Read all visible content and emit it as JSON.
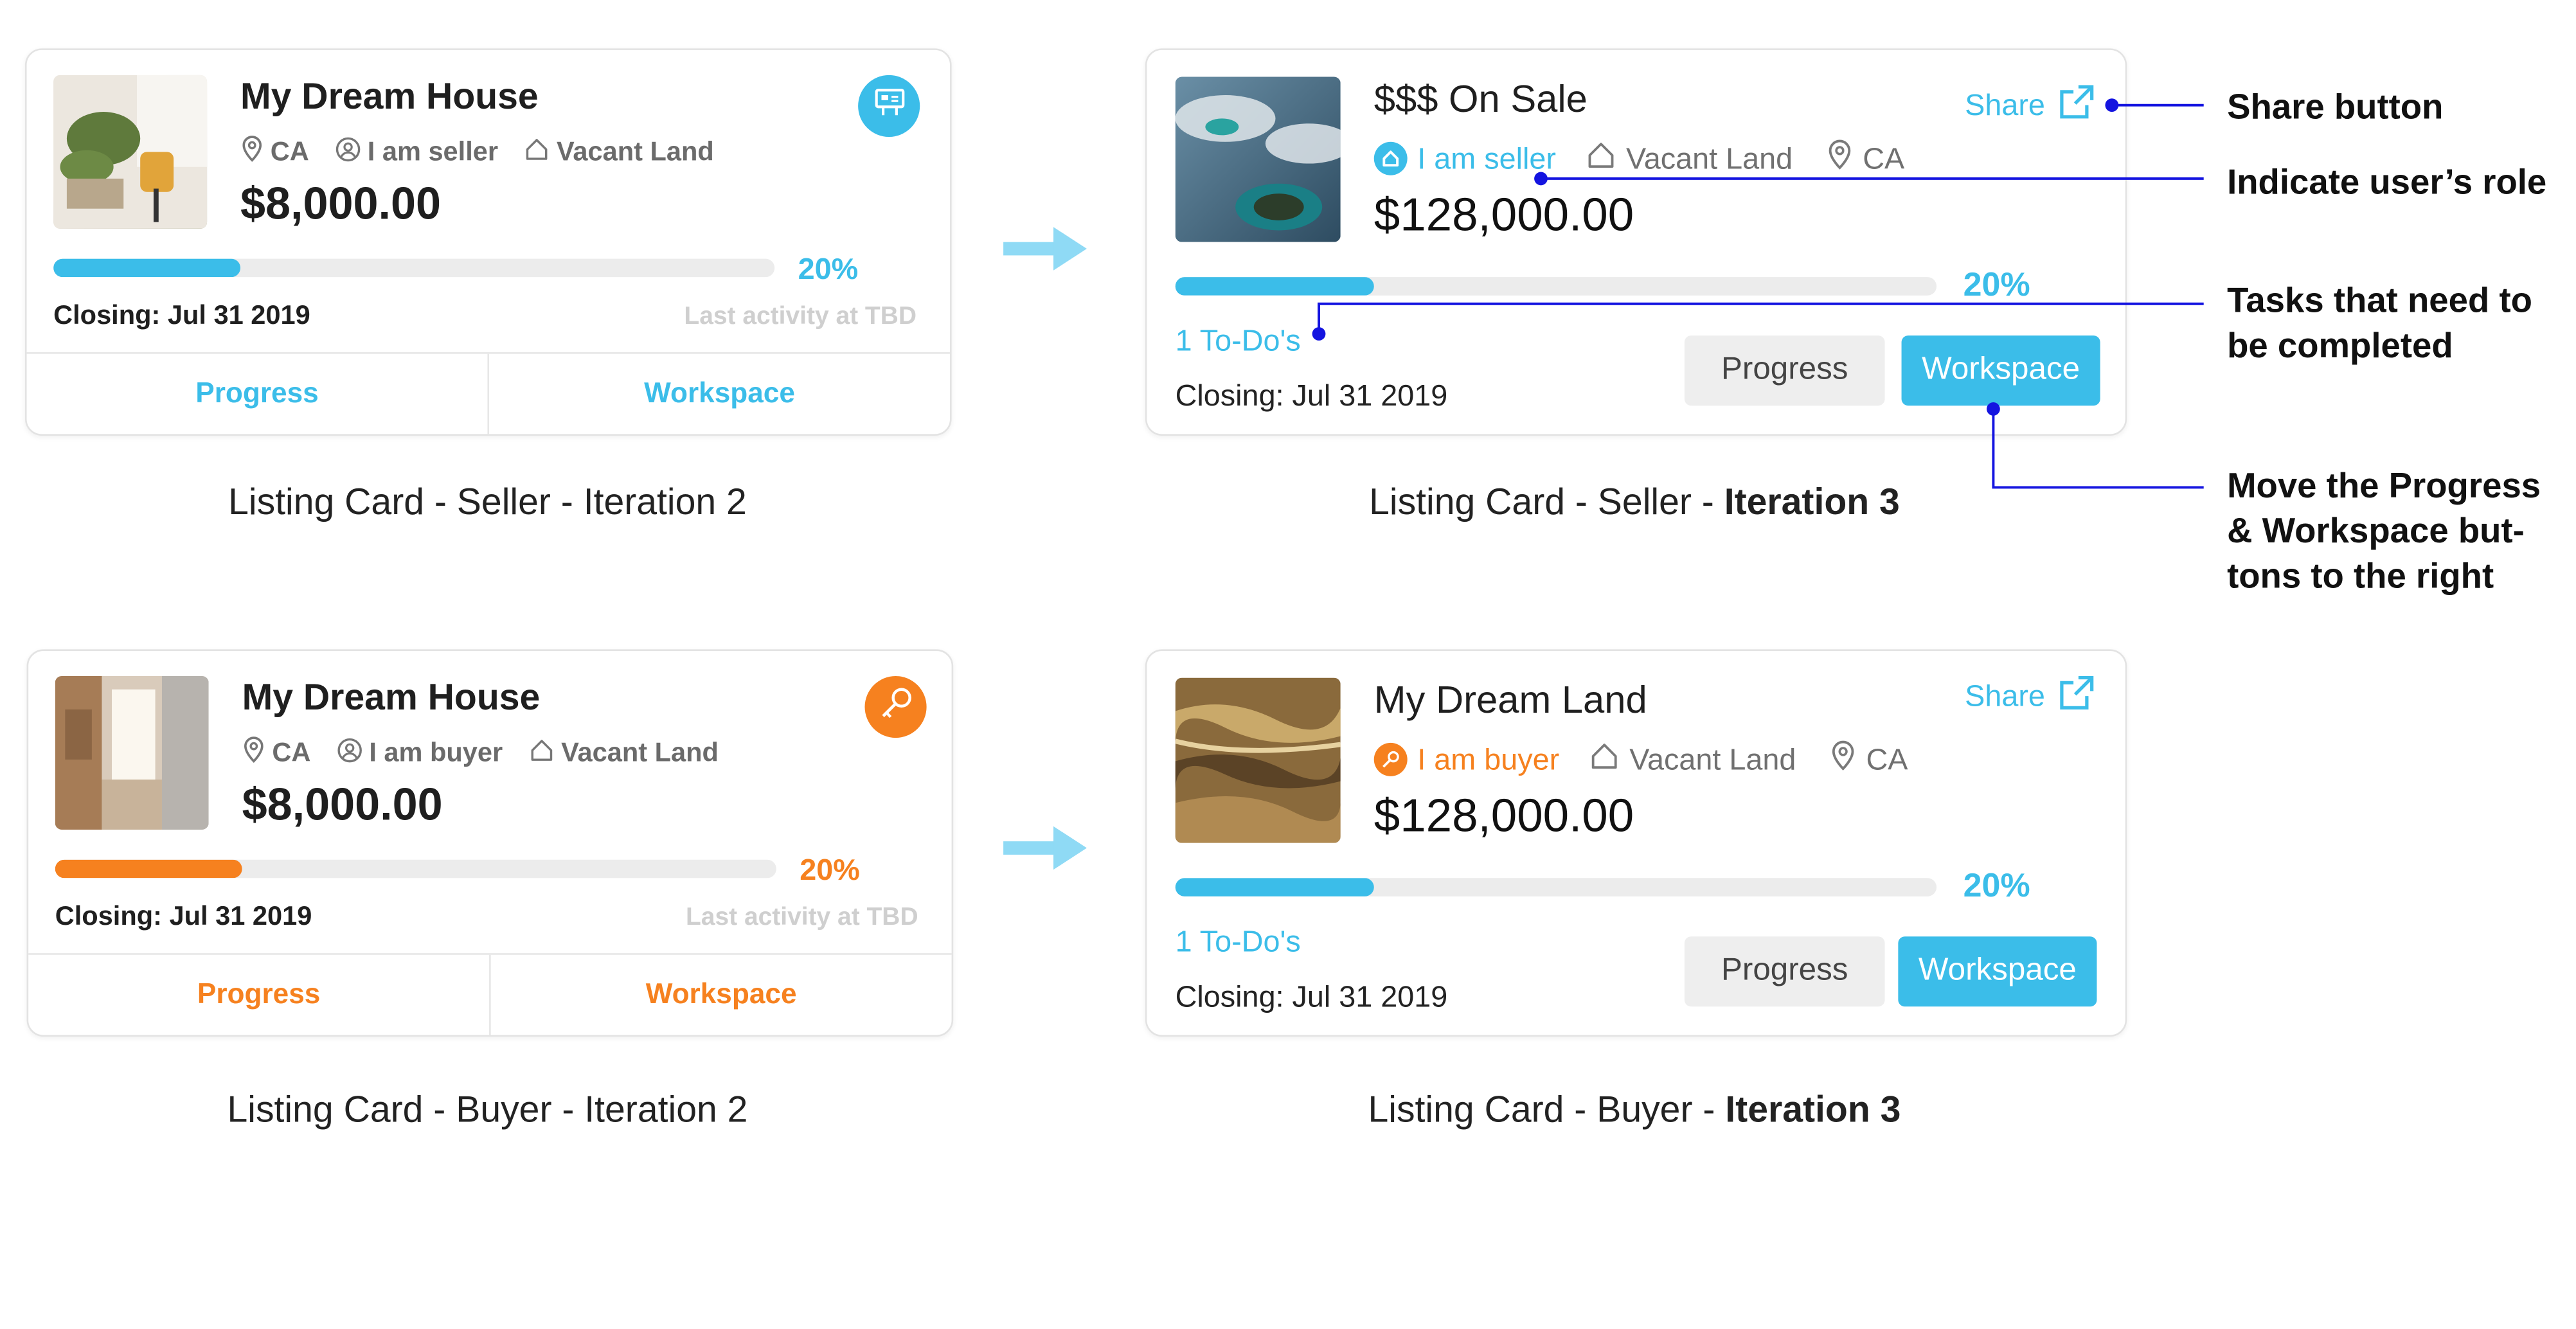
{
  "colors": {
    "seller_accent": "#3bbde9",
    "buyer_accent": "#f6811f",
    "annotation_line": "#1414e0",
    "arrow": "#8fdaf5",
    "gray_button": "#eeeeee"
  },
  "cards": {
    "seller_v2": {
      "title": "My Dream House",
      "location": "CA",
      "role": "I am seller",
      "property_type": "Vacant Land",
      "price": "$8,000.00",
      "progress_value": 0.2,
      "progress_label": "20%",
      "closing": "Closing: Jul 31 2019",
      "last_activity": "Last activity at TBD",
      "progress_button": "Progress",
      "workspace_button": "Workspace",
      "badge_icon": "sale-sign-icon",
      "thumbnail": "living-room-plants-photo"
    },
    "seller_v3": {
      "title": "$$$ On Sale",
      "role": "I am seller",
      "property_type": "Vacant Land",
      "location": "CA",
      "price": "$128,000.00",
      "progress_value": 0.2,
      "progress_label": "20%",
      "todos": "1 To-Do's",
      "closing": "Closing: Jul 31 2019",
      "share_label": "Share",
      "progress_button": "Progress",
      "workspace_button": "Workspace",
      "thumbnail": "aerial-island-photo"
    },
    "buyer_v2": {
      "title": "My Dream House",
      "location": "CA",
      "role": "I am buyer",
      "property_type": "Vacant Land",
      "price": "$8,000.00",
      "progress_value": 0.2,
      "progress_label": "20%",
      "closing": "Closing: Jul 31 2019",
      "last_activity": "Last activity at TBD",
      "progress_button": "Progress",
      "workspace_button": "Workspace",
      "badge_icon": "key-icon",
      "thumbnail": "bright-kitchen-photo"
    },
    "buyer_v3": {
      "title": "My Dream Land",
      "role": "I am buyer",
      "property_type": "Vacant Land",
      "location": "CA",
      "price": "$128,000.00",
      "progress_value": 0.2,
      "progress_label": "20%",
      "todos": "1 To-Do's",
      "closing": "Closing: Jul 31 2019",
      "share_label": "Share",
      "progress_button": "Progress",
      "workspace_button": "Workspace",
      "thumbnail": "aerial-land-photo"
    }
  },
  "captions": {
    "seller_v2": "Listing Card - Seller - Iteration 2",
    "seller_v3_prefix": "Listing Card - Seller - ",
    "seller_v3_bold": "Iteration 3",
    "buyer_v2": "Listing Card - Buyer - Iteration 2",
    "buyer_v3_prefix": "Listing Card - Buyer - ",
    "buyer_v3_bold": "Iteration 3"
  },
  "annotations": {
    "share": "Share button",
    "role": "Indicate user’s role",
    "tasks_line1": "Tasks that need to",
    "tasks_line2": "be completed",
    "move_line1": "Move the Progress",
    "move_line2": "& Workspace but-",
    "move_line3": "tons to the right"
  },
  "icons": {
    "location": "location-pin-icon",
    "user": "user-circle-icon",
    "house": "house-outline-icon",
    "external_link": "external-link-icon",
    "arrow": "right-arrow-icon"
  }
}
